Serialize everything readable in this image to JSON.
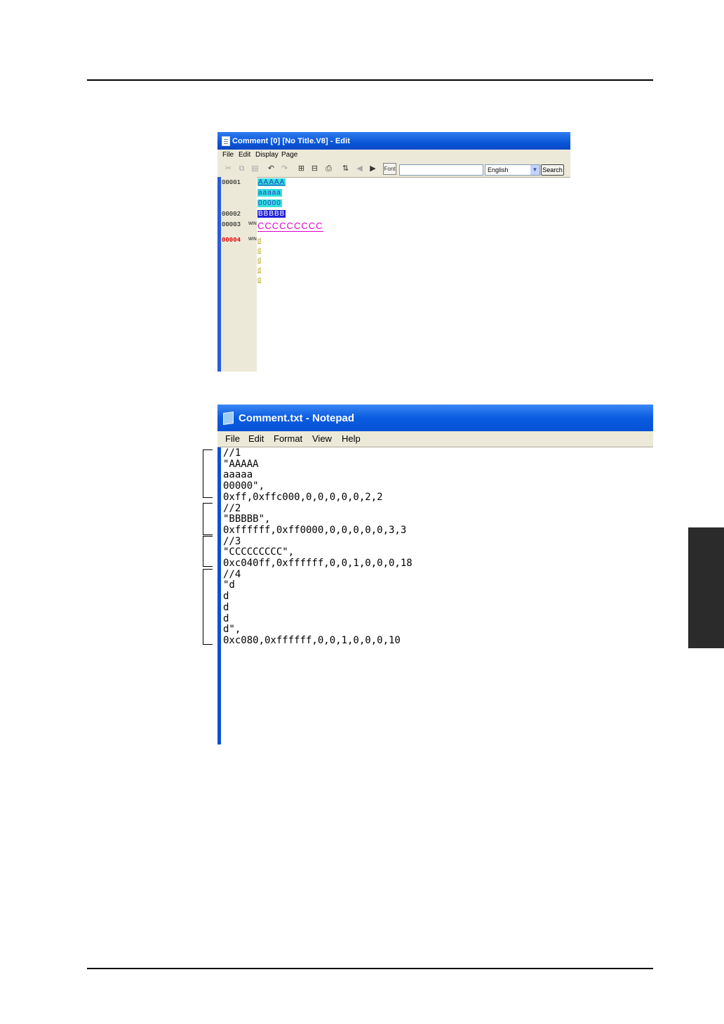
{
  "editor": {
    "title": "Comment [0] [No Title.V8] - Edit",
    "menu": [
      "File",
      "Edit",
      "Display",
      "Page"
    ],
    "toolbar": {
      "font_label": "Font",
      "search_value": "",
      "language": "English",
      "search_label": "Search"
    },
    "line_numbers": [
      "00001",
      "00002",
      "00003",
      "00004"
    ],
    "win_marks": [
      "WIN",
      "WIN"
    ],
    "rows": {
      "r1a": "AAAAA",
      "r1b": "aaaaa",
      "r1c": "00000",
      "r2": "BBBBB",
      "r3": "CCCCCCCCC",
      "r4": [
        "d",
        "d",
        "d",
        "d",
        "d"
      ]
    }
  },
  "notepad": {
    "title": "Comment.txt - Notepad",
    "menu": [
      "File",
      "Edit",
      "Format",
      "View",
      "Help"
    ],
    "lines": [
      "//1",
      "\"AAAAA",
      "aaaaa",
      "00000\",",
      "0xff,0xffc000,0,0,0,0,0,2,2",
      "//2",
      "\"BBBBB\",",
      "0xffffff,0xff0000,0,0,0,0,0,3,3",
      "//3",
      "\"CCCCCCCCC\",",
      "0xc040ff,0xffffff,0,0,1,0,0,0,18",
      "//4",
      "\"d",
      "d",
      "d",
      "d",
      "d\",",
      "0xc080,0xffffff,0,0,1,0,0,0,10"
    ]
  }
}
